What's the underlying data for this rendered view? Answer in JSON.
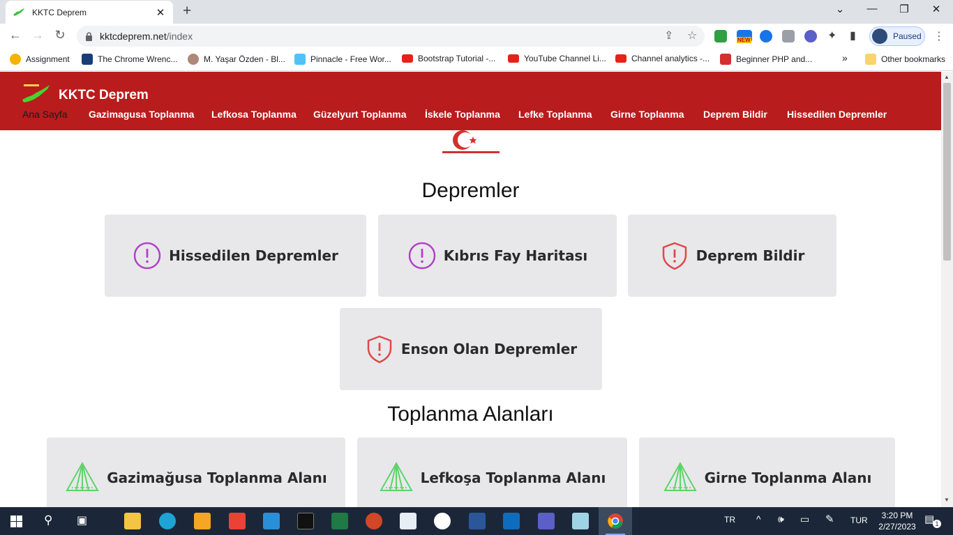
{
  "browser": {
    "tab_title": "KKTC Deprem",
    "url_host": "kktcdeprem.net",
    "url_path": "/index",
    "profile_status": "Paused",
    "bookmarks": [
      {
        "label": "Assignment",
        "icon_color": "#f4b400"
      },
      {
        "label": "The Chrome Wrenc...",
        "icon_color": "#1a3d7a"
      },
      {
        "label": "M. Yaşar Özden - Bl...",
        "icon_color": "#b0877a"
      },
      {
        "label": "Pinnacle - Free Wor...",
        "icon_color": "#4fc3f7"
      },
      {
        "label": "Bootstrap Tutorial -...",
        "icon_color": "#e62117"
      },
      {
        "label": "YouTube Channel Li...",
        "icon_color": "#e62117"
      },
      {
        "label": "Channel analytics -...",
        "icon_color": "#e62117"
      },
      {
        "label": "Beginner PHP and...",
        "icon_color": "#d32f2f"
      }
    ],
    "bookmarks_overflow": "»",
    "other_bookmarks": "Other bookmarks",
    "new_badge": "NEW"
  },
  "site": {
    "brand": "KKTC Deprem",
    "nav": [
      "Ana Sayfa",
      "Gazimagusa Toplanma",
      "Lefkosa Toplanma",
      "Güzelyurt Toplanma",
      "İskele Toplanma",
      "Lefke Toplanma",
      "Girne Toplanma",
      "Deprem Bildir",
      "Hissedilen Depremler"
    ],
    "active_nav_index": 0,
    "colors": {
      "header": "#b91c1c",
      "card_bg": "#e8e8eb",
      "alert_purple": "#b340c8",
      "shield_red": "#e04848",
      "tent_green": "#5dd46a"
    }
  },
  "depremler": {
    "title": "Depremler",
    "cards": [
      {
        "label": "Hissedilen Depremler",
        "icon": "exclamation-circle-icon"
      },
      {
        "label": "Kıbrıs Fay Haritası",
        "icon": "exclamation-circle-icon"
      },
      {
        "label": "Deprem Bildir",
        "icon": "shield-alert-icon"
      },
      {
        "label": "Enson Olan Depremler",
        "icon": "shield-alert-icon"
      }
    ]
  },
  "toplanma": {
    "title": "Toplanma Alanları",
    "cards": [
      {
        "label": "Gazimağusa Toplanma Alanı",
        "icon": "tent-icon"
      },
      {
        "label": "Lefkoşa Toplanma Alanı",
        "icon": "tent-icon"
      },
      {
        "label": "Girne Toplanma Alanı",
        "icon": "tent-icon"
      }
    ]
  },
  "taskbar": {
    "language": "TR",
    "keyboard": "TUR",
    "time": "3:20 PM",
    "date": "2/27/2023",
    "notification_count": "1"
  }
}
